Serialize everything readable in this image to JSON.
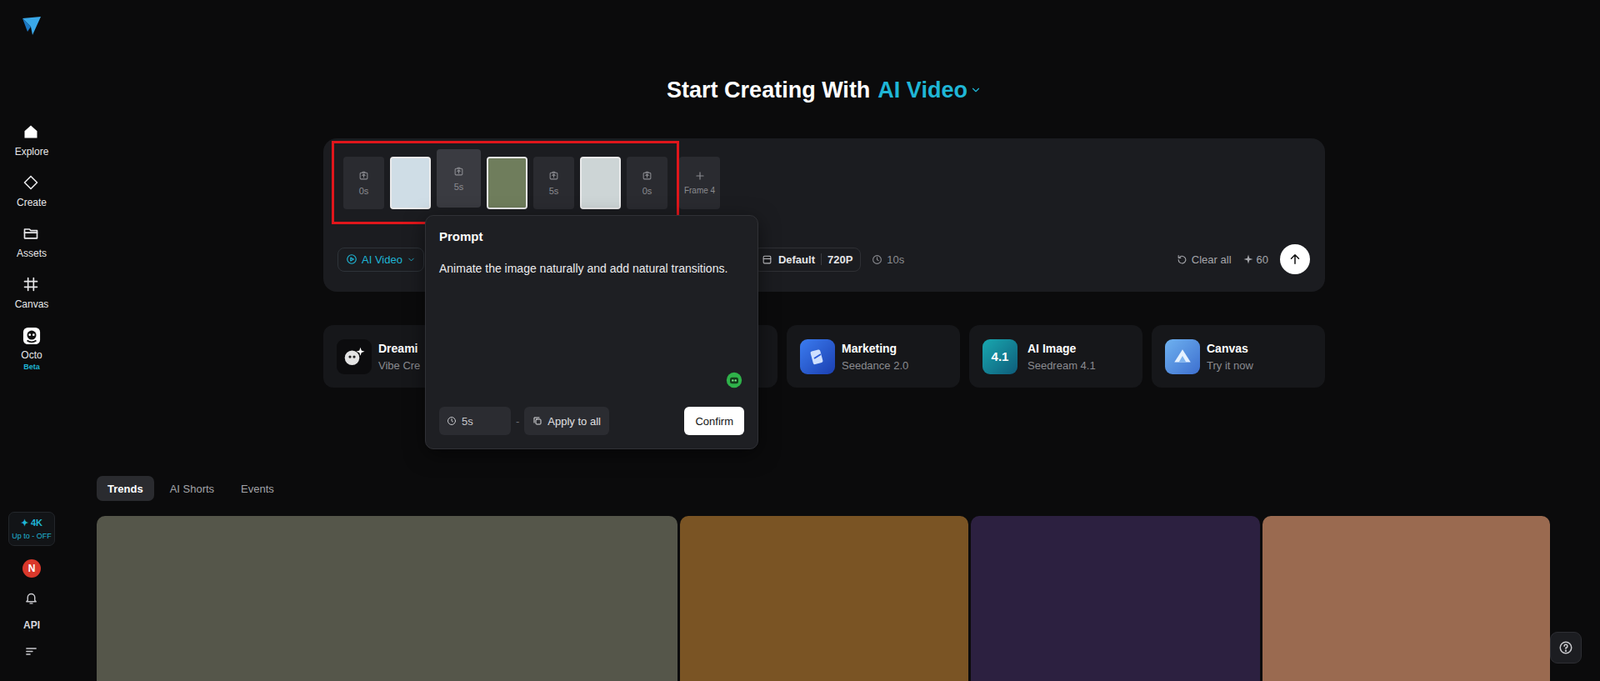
{
  "sidebar": {
    "items": [
      {
        "kind": "explore",
        "label": "Explore"
      },
      {
        "kind": "create",
        "label": "Create"
      },
      {
        "kind": "assets",
        "label": "Assets"
      },
      {
        "kind": "canvas",
        "label": "Canvas"
      },
      {
        "kind": "octo",
        "label": "Octo",
        "badge": "Beta"
      }
    ],
    "promo": {
      "title": "✦ 4K",
      "subtitle": "Up to - OFF"
    },
    "avatar": "N",
    "api": "API"
  },
  "header": {
    "prefix": "Start Creating With",
    "mode": "AI Video"
  },
  "composer": {
    "highlighted": true,
    "frames": [
      {
        "kind": "slot",
        "duration": "0s",
        "selected": false
      },
      {
        "kind": "image",
        "color": "#cfdde6"
      },
      {
        "kind": "slot",
        "duration": "5s",
        "selected": true
      },
      {
        "kind": "image",
        "color": "#6f7d5c"
      },
      {
        "kind": "slot",
        "duration": "5s",
        "selected": false
      },
      {
        "kind": "image",
        "color": "#cdd5d6"
      },
      {
        "kind": "slot",
        "duration": "0s",
        "selected": false
      }
    ],
    "add_frame": "Frame 4",
    "toolbar": {
      "mode": "AI Video",
      "ratio": "Default",
      "resolution": "720P",
      "duration": "10s",
      "clear": "Clear all",
      "credits": "60"
    }
  },
  "popup": {
    "title": "Prompt",
    "text": "Animate the image naturally and add natural transitions.",
    "duration": "5s",
    "separator": "-",
    "apply": "Apply to all",
    "confirm": "Confirm"
  },
  "cards": [
    {
      "kind": "dreamina",
      "title": "Dreami",
      "subtitle": "Vibe Cre"
    },
    {
      "kind": "covered"
    },
    {
      "kind": "marketing",
      "title": "Marketing",
      "subtitle": "Seedance 2.0"
    },
    {
      "kind": "image",
      "icon_text": "4.1",
      "title": "AI Image",
      "subtitle": "Seedream 4.1"
    },
    {
      "kind": "canvas",
      "title": "Canvas",
      "subtitle": "Try it now"
    }
  ],
  "tabs": [
    {
      "label": "Trends",
      "selected": true
    },
    {
      "label": "AI Shorts",
      "selected": false
    },
    {
      "label": "Events",
      "selected": false
    }
  ],
  "gallery": [
    {
      "color": "#55564a"
    },
    {
      "color": "#7a5424"
    },
    {
      "color": "#2c2040"
    },
    {
      "color": "#9a6a50"
    }
  ]
}
